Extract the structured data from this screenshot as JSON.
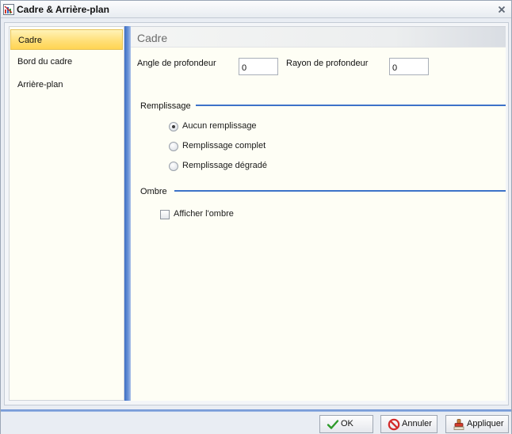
{
  "window": {
    "title": "Cadre & Arrière-plan"
  },
  "sidebar": {
    "items": [
      {
        "label": "Cadre",
        "active": true
      },
      {
        "label": "Bord du cadre",
        "active": false
      },
      {
        "label": "Arrière-plan",
        "active": false
      }
    ]
  },
  "panel": {
    "title": "Cadre",
    "depth_angle": {
      "label": "Angle de profondeur",
      "value": "0"
    },
    "depth_radius": {
      "label": "Rayon de profondeur",
      "value": "0"
    },
    "fill": {
      "label": "Remplissage",
      "options": [
        {
          "label": "Aucun remplissage",
          "checked": true
        },
        {
          "label": "Remplissage complet",
          "checked": false
        },
        {
          "label": "Remplissage dégradé",
          "checked": false
        }
      ]
    },
    "shadow": {
      "label": "Ombre",
      "show_shadow": {
        "label": "Afficher l'ombre",
        "checked": false
      }
    }
  },
  "footer": {
    "ok_label": "OK",
    "cancel_label": "Annuler",
    "apply_label": "Appliquer"
  },
  "colors": {
    "accent": "#3d72c8",
    "active_nav": "#ffe07a",
    "panel_bg": "#fefef5"
  }
}
